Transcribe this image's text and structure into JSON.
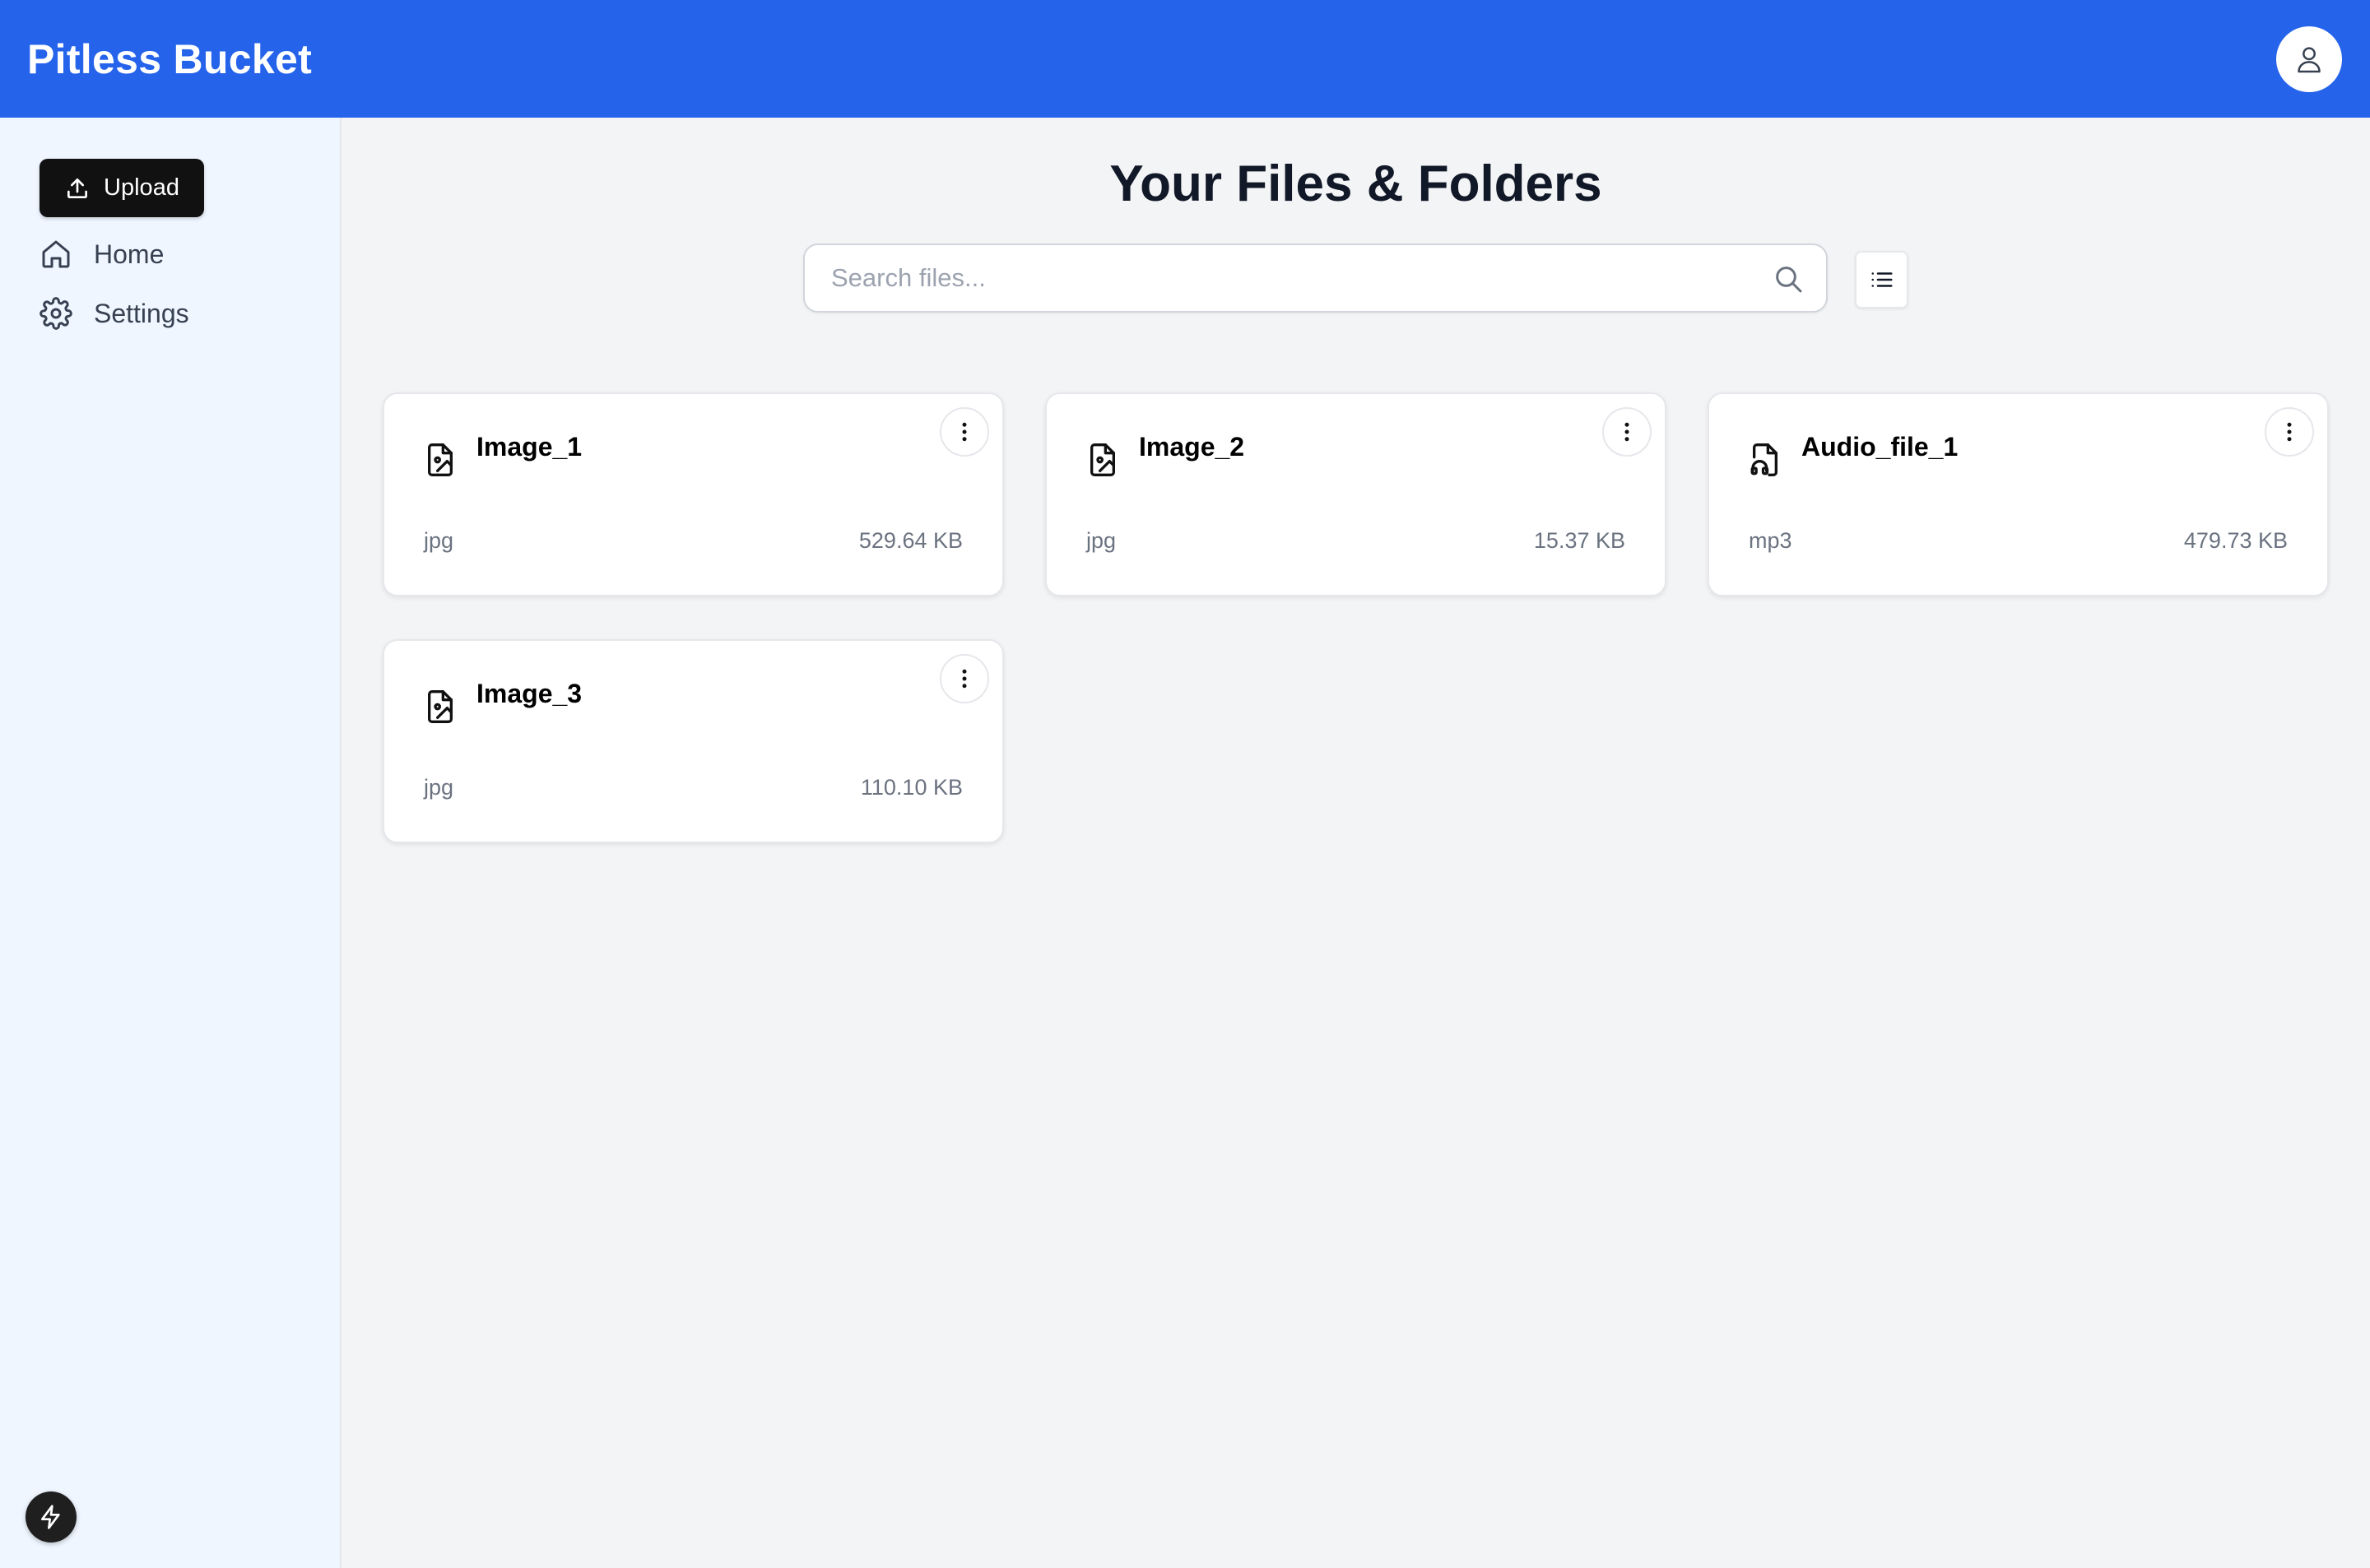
{
  "app": {
    "title": "Pitless Bucket"
  },
  "header": {
    "avatar_icon": "user-icon"
  },
  "sidebar": {
    "upload_label": "Upload",
    "items": [
      {
        "label": "Home",
        "icon": "home-icon"
      },
      {
        "label": "Settings",
        "icon": "gear-icon"
      }
    ],
    "footer_icon": "bolt-icon"
  },
  "main": {
    "title": "Your Files & Folders",
    "search": {
      "placeholder": "Search files...",
      "value": ""
    },
    "view_toggle_icon": "list-view-icon",
    "files": [
      {
        "name": "Image_1",
        "type": "jpg",
        "size": "529.64 KB",
        "icon": "image-file-icon"
      },
      {
        "name": "Image_2",
        "type": "jpg",
        "size": "15.37 KB",
        "icon": "image-file-icon"
      },
      {
        "name": "Audio_file_1",
        "type": "mp3",
        "size": "479.73 KB",
        "icon": "audio-file-icon"
      },
      {
        "name": "Image_3",
        "type": "jpg",
        "size": "110.10 KB",
        "icon": "image-file-icon"
      }
    ]
  },
  "colors": {
    "header_bg": "#2563eb",
    "sidebar_bg": "#eff6ff",
    "page_bg": "#f3f4f6",
    "upload_bg": "#111111"
  }
}
